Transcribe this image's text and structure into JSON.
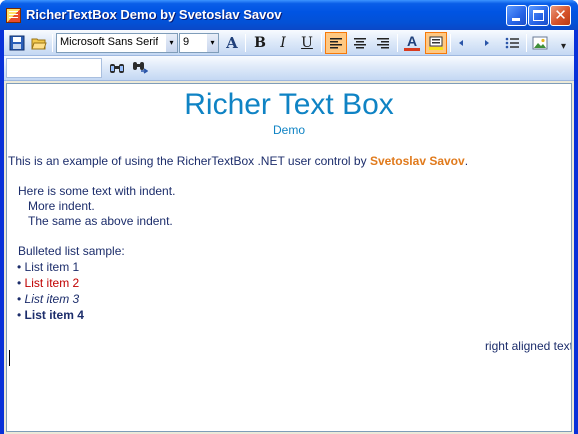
{
  "window": {
    "title": "RicherTextBox Demo by Svetoslav Savov",
    "close_glyph": "✕"
  },
  "toolbar": {
    "font_family": "Microsoft Sans Serif",
    "font_size": "9",
    "grow_font_glyph": "A",
    "bold_glyph": "B",
    "italic_glyph": "I",
    "underline_glyph": "U",
    "font_color_glyph": "A",
    "combo_arrow": "▾",
    "overflow_glyph": "▾",
    "icons": [
      "save-icon",
      "open-icon",
      "grow-font-icon",
      "bold-icon",
      "italic-icon",
      "underline-icon",
      "align-left-icon",
      "align-center-icon",
      "align-right-icon",
      "font-color-icon",
      "highlight-icon",
      "indent-decrease-icon",
      "indent-increase-icon",
      "bullets-icon",
      "insert-picture-icon",
      "find-icon",
      "find-replace-icon"
    ],
    "accent_active": "#ffc882"
  },
  "document": {
    "title": "Richer Text Box",
    "subtitle": "Demo",
    "intro_prefix": "This is an example of using the RicherTextBox .NET user control by ",
    "intro_author": "Svetoslav Savov",
    "intro_suffix": ".",
    "indent_1": "Here is some text with indent.",
    "indent_2": "More indent.",
    "indent_3": "The same as above indent.",
    "bullets_heading": "Bulleted list sample:",
    "bullet_mark": "•",
    "bullets": [
      "List item 1",
      "List item 2",
      "List item 3",
      "List item 4"
    ],
    "right_aligned": "right aligned text",
    "colors": {
      "title": "#0f83c4",
      "text": "#1c2d6b",
      "author": "#e07a1c",
      "red_item": "#c00000"
    }
  }
}
